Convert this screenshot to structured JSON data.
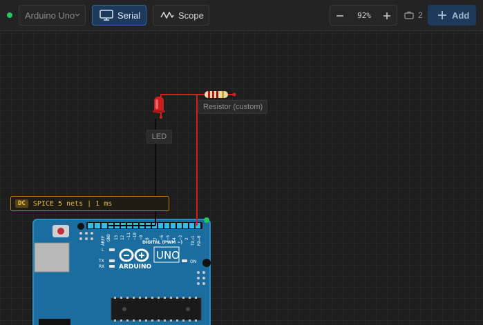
{
  "toolbar": {
    "board": "Arduino Uno",
    "serial_label": "Serial",
    "scope_label": "Scope",
    "zoom_value": "92%",
    "parts_count": "2",
    "add_label": "Add"
  },
  "canvas": {
    "led_label": "LED",
    "resistor_label": "Resistor (custom)",
    "spice_badge": "DC",
    "spice_text": "SPICE 5 nets | 1 ms"
  },
  "board": {
    "pin_aref": "AREF",
    "pin_gnd": "GND",
    "digital_pins": [
      "13",
      "12",
      "~11",
      "~10",
      "~9",
      "8",
      "7",
      "~6",
      "~5",
      "4",
      "~3",
      "2",
      "TX→1",
      "RX←0"
    ],
    "digital_label": "DIGITAL (PWM ~)",
    "led_l": "L",
    "led_tx": "TX",
    "led_rx": "RX",
    "logo_text": "ARDUINO",
    "model": "UNO",
    "on_label": "ON"
  },
  "colors": {
    "accent": "#2f6ea8",
    "board_blue": "#1a6d9e",
    "wire_red": "#d42020",
    "wire_black": "#0a0a0a",
    "status_green": "#22c55e"
  }
}
